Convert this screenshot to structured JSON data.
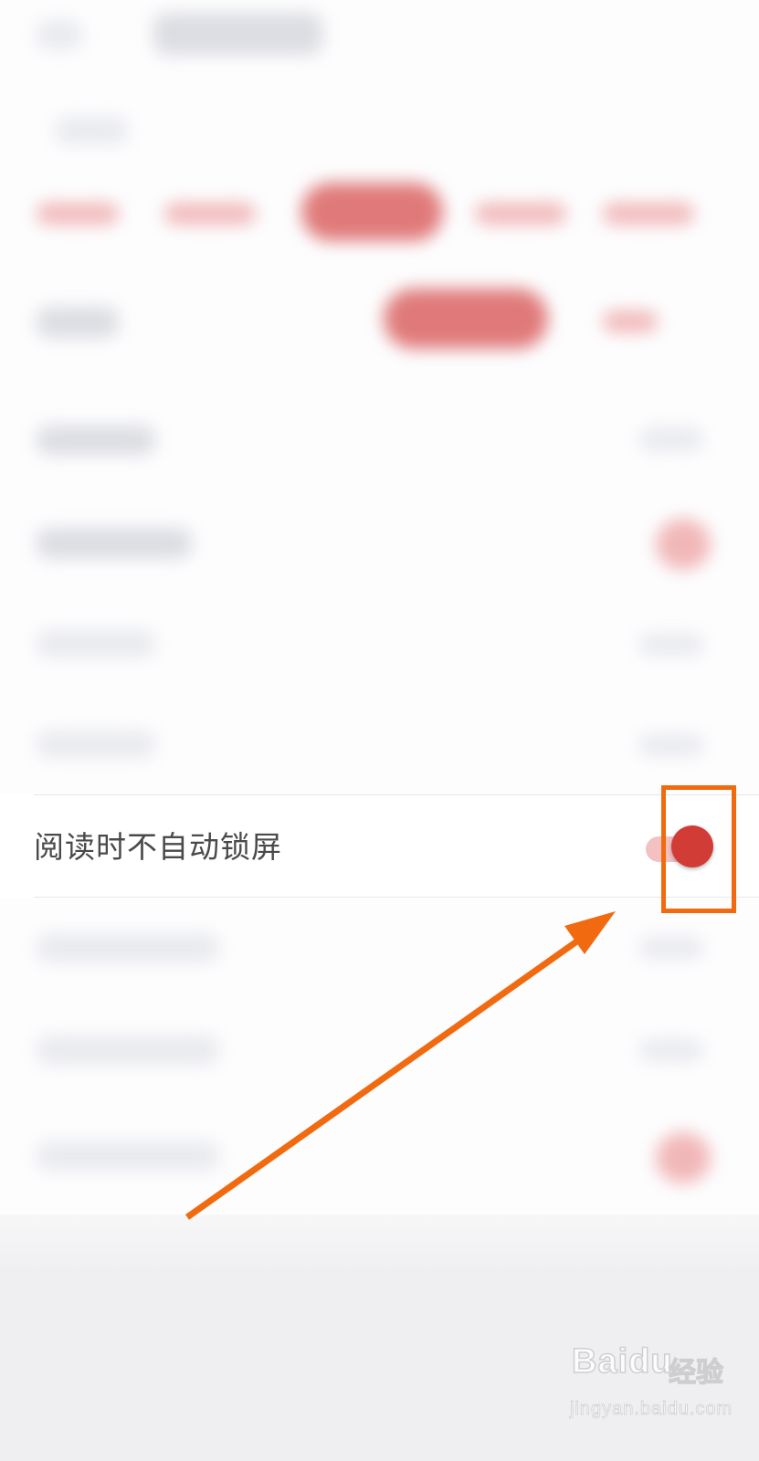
{
  "setting_row": {
    "label": "阅读时不自动锁屏",
    "toggle_state": "on"
  },
  "colors": {
    "accent": "#d23c36",
    "toggle_track": "#f4c1c2",
    "annotation": "#f26a10"
  },
  "annotation": {
    "box_icon": "highlight-rectangle",
    "arrow_icon": "pointer-arrow"
  },
  "watermark": {
    "brand": "Baidu",
    "brand_cn": "经验",
    "url": "jingyan.baidu.com"
  }
}
